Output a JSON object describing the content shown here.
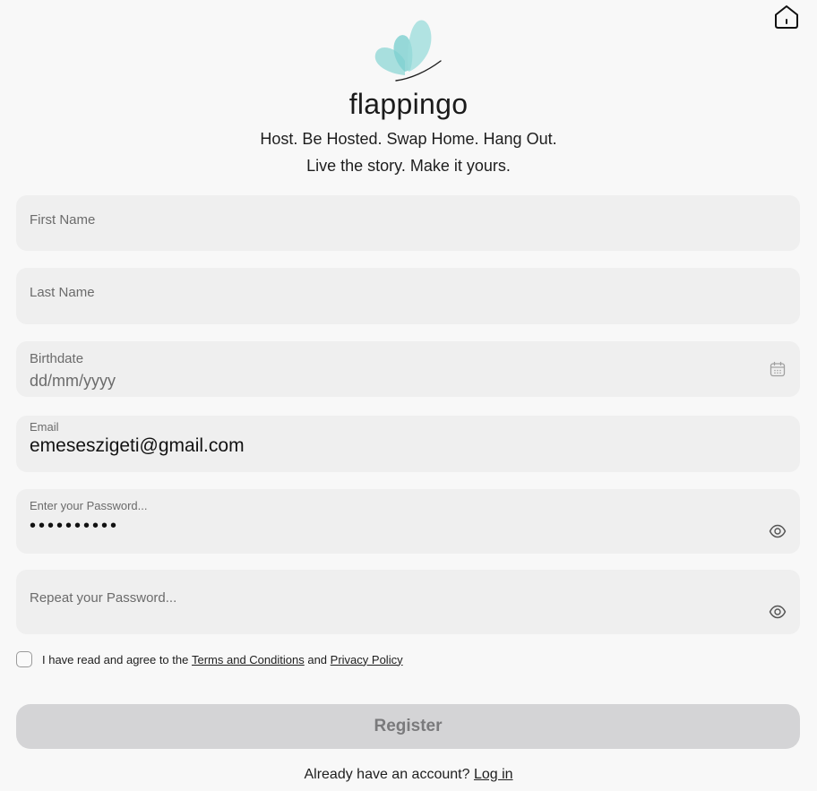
{
  "header": {
    "home_icon": "home-icon",
    "logo_icon": "butterfly-logo-icon",
    "brand": "flappingo",
    "tagline_line1": "Host. Be Hosted. Swap Home. Hang Out.",
    "tagline_line2": "Live the story. Make it yours."
  },
  "form": {
    "first_name": {
      "label": "First Name",
      "value": ""
    },
    "last_name": {
      "label": "Last Name",
      "value": ""
    },
    "birthdate": {
      "label": "Birthdate",
      "placeholder": "dd/mm/yyyy",
      "icon": "calendar-icon"
    },
    "email": {
      "label": "Email",
      "value": "emeseszigeti@gmail.com"
    },
    "password": {
      "label": "Enter your Password...",
      "value": "••••••••••",
      "icon": "eye-icon"
    },
    "repeat_password": {
      "label": "Repeat your Password...",
      "value": "",
      "icon": "eye-icon"
    },
    "terms": {
      "checked": false,
      "prefix": "I have read and agree to the",
      "terms_link": "Terms and Conditions",
      "conjunction": "and",
      "privacy_link": "Privacy Policy"
    },
    "register_label": "Register"
  },
  "footer": {
    "prompt": "Already have an account?",
    "login_link": "Log in"
  },
  "colors": {
    "background": "#f8f8f8",
    "field_background": "#efefef",
    "button_disabled": "#d4d4d6",
    "logo_teal": "#7fcfd0"
  }
}
